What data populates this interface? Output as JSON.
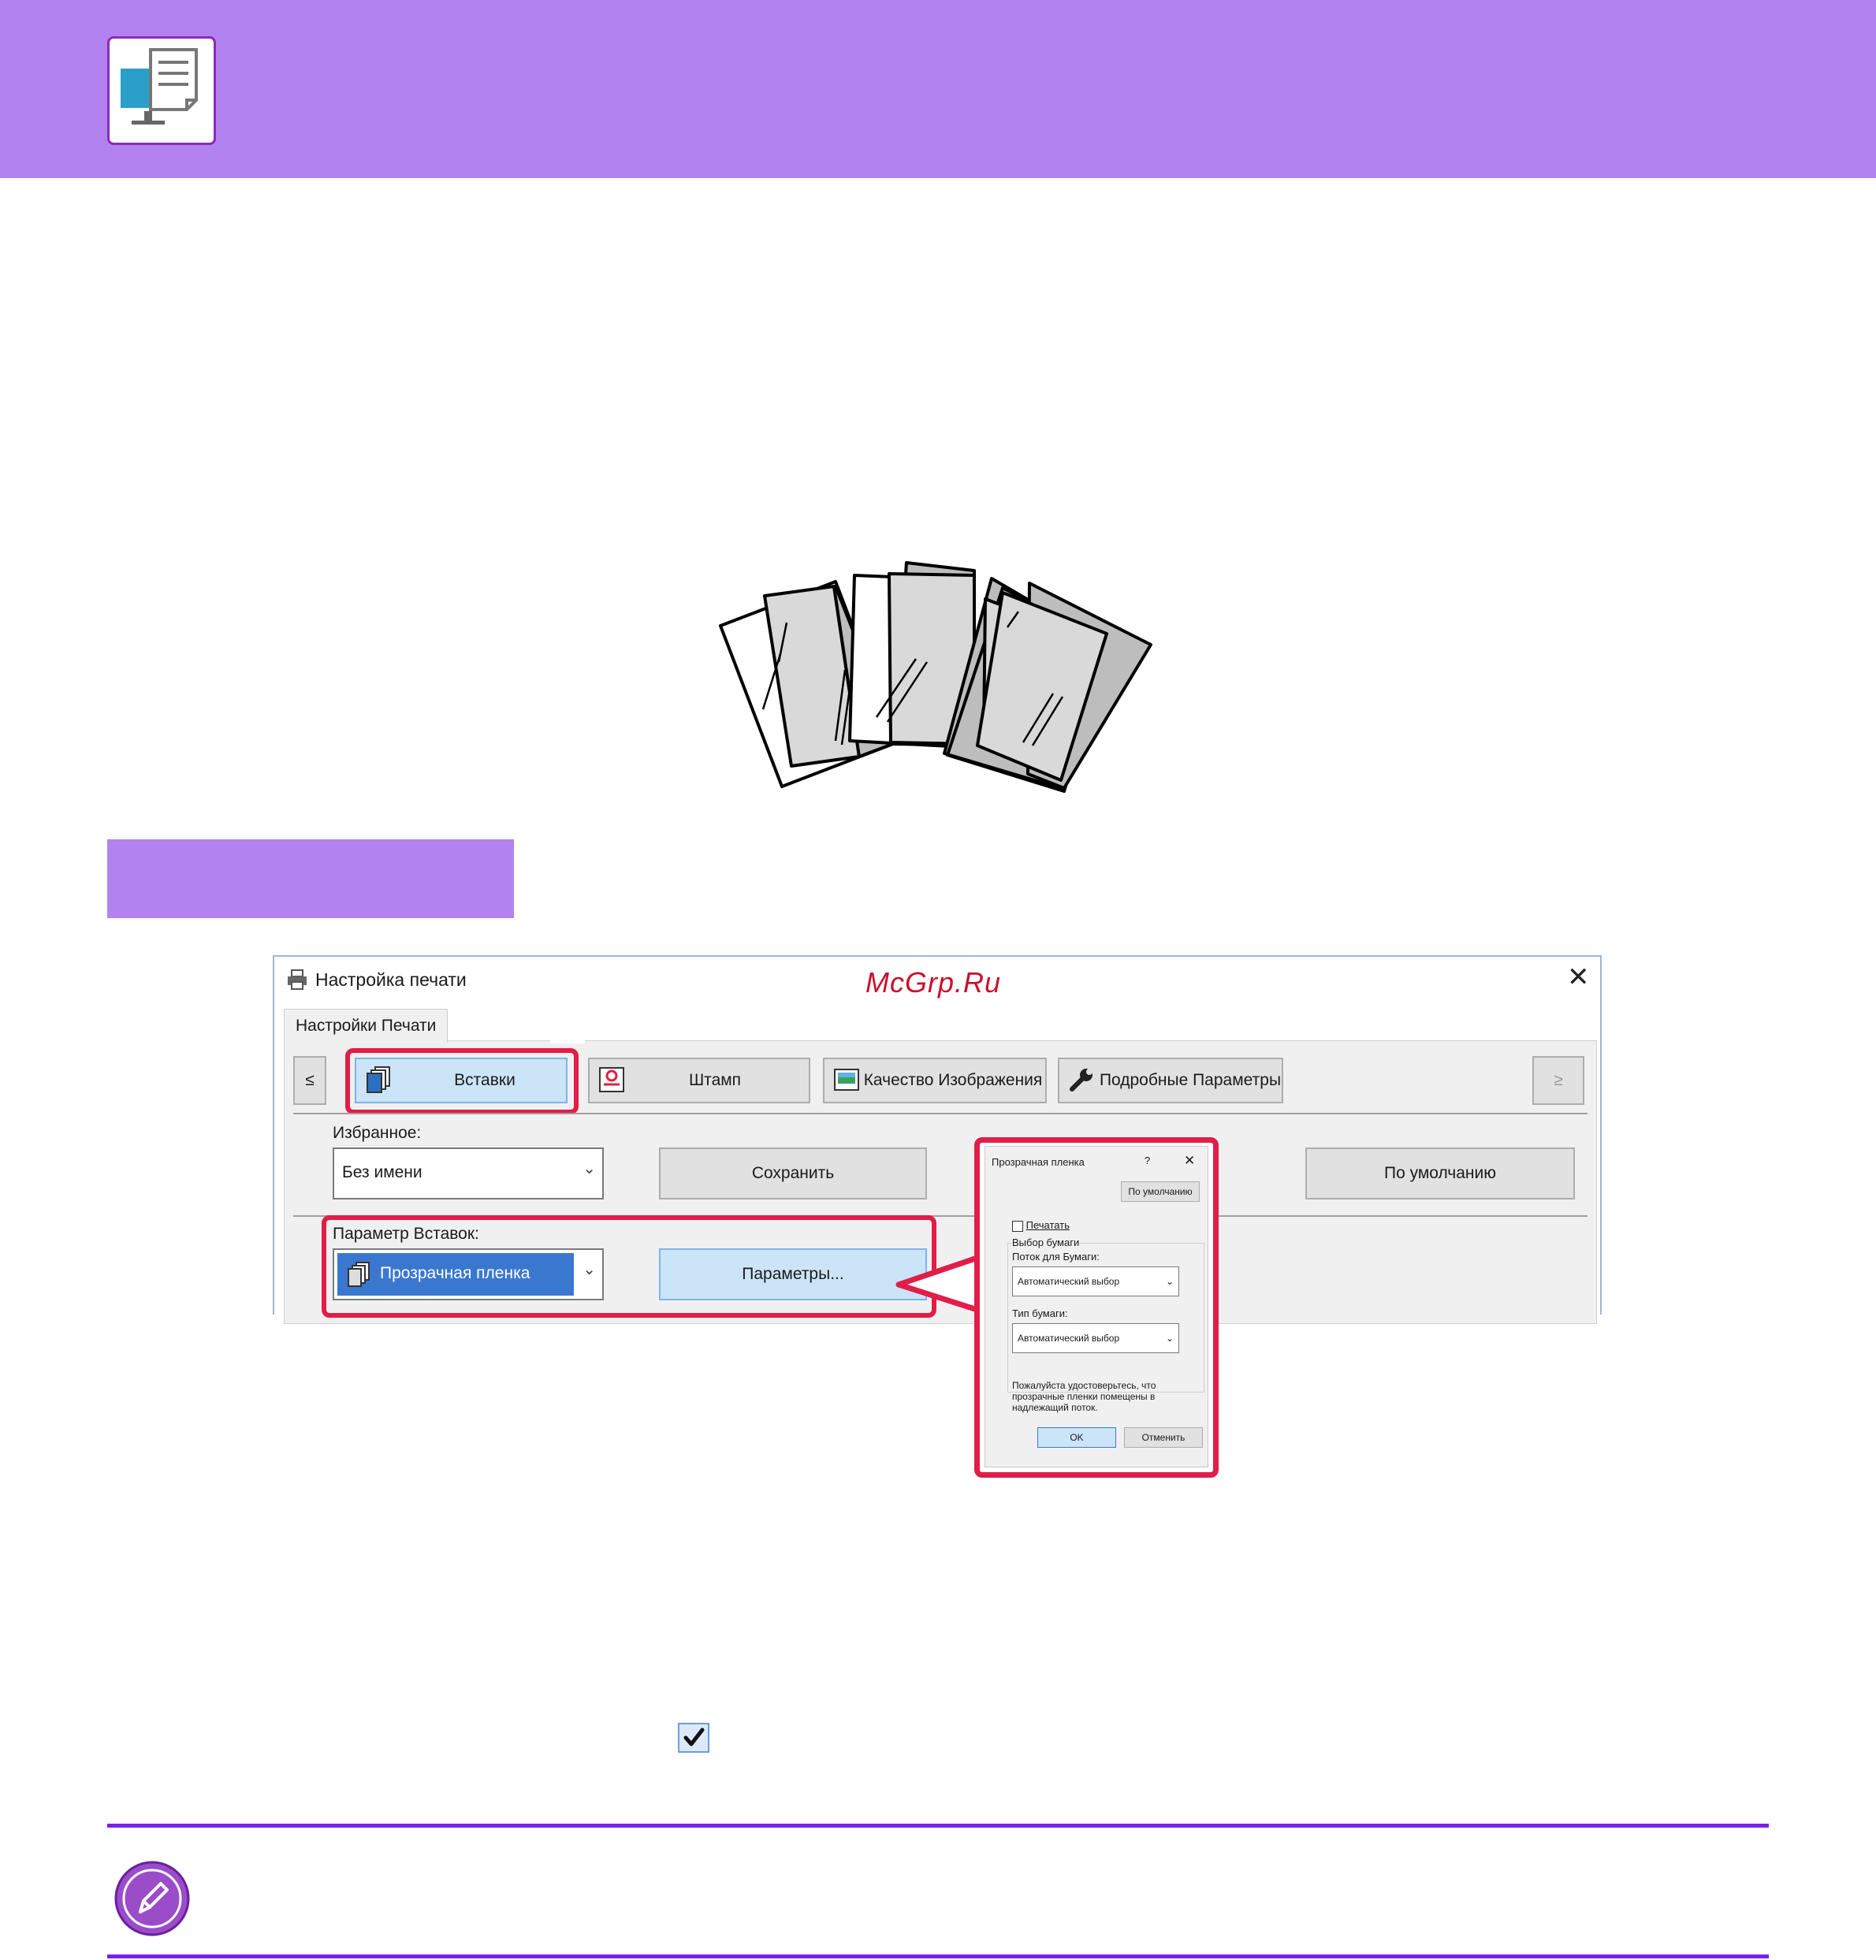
{
  "colors": {
    "accent": "#b283f0",
    "rule": "#7a1ff0",
    "highlight": "#e11d48",
    "watermark": "#c8102e"
  },
  "header": {
    "icon": "printer-driver-icon"
  },
  "illustration": {
    "icon": "transparency-sheets-illustration"
  },
  "dialog": {
    "title": "Настройка печати",
    "watermark": "McGrp.Ru",
    "close": "✕",
    "tab": "Настройки Печати",
    "nav_prev": "≤",
    "nav_next": "≥",
    "toolbar": [
      {
        "label": "Вставки",
        "icon": "inserts-icon",
        "selected": true
      },
      {
        "label": "Штамп",
        "icon": "stamp-icon"
      },
      {
        "label": "Качество Изображения",
        "icon": "image-quality-icon"
      },
      {
        "label": "Подробные Параметры",
        "icon": "wrench-icon"
      }
    ],
    "favorites_label": "Избранное:",
    "favorites_value": "Без имени",
    "save": "Сохранить",
    "defaults": "По умолчанию",
    "insert_param_label": "Параметр Вставок:",
    "insert_value": "Прозрачная пленка",
    "params": "Параметры..."
  },
  "popup": {
    "title": "Прозрачная пленка",
    "help": "?",
    "close": "✕",
    "defaults": "По умолчанию",
    "print_checkbox": "Печатать",
    "group": "Выбор бумаги",
    "tray_label": "Поток для Бумаги:",
    "tray_value": "Автоматический выбор",
    "type_label": "Тип бумаги:",
    "type_value": "Автоматический выбор",
    "note": [
      "Пожалуйста удостоверьтесь, что",
      "прозрачные пленки помещены в",
      "надлежащий поток."
    ],
    "ok": "OK",
    "cancel": "Отменить"
  },
  "checkbox": {
    "icon": "checkmark-icon",
    "checked": true
  },
  "note": {
    "icon": "pencil-note-icon"
  }
}
